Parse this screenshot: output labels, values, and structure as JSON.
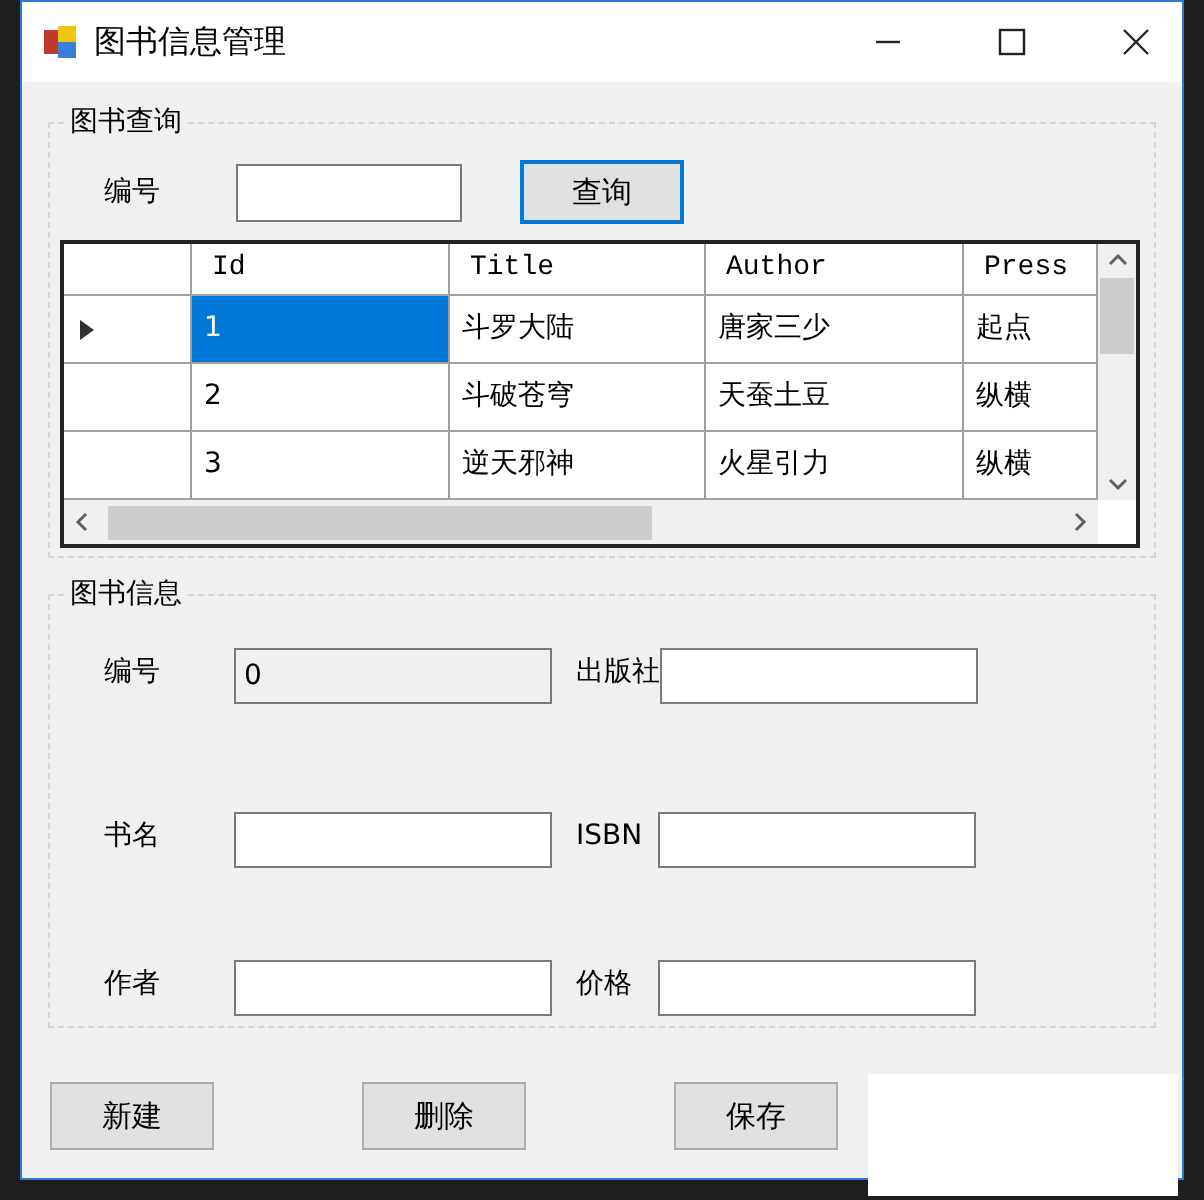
{
  "window": {
    "title": "图书信息管理"
  },
  "query_group": {
    "title": "图书查询",
    "label": "编号",
    "button": "查询"
  },
  "grid": {
    "columns": [
      "Id",
      "Title",
      "Author",
      "Press"
    ],
    "rows": [
      {
        "selected": true,
        "cells": [
          "1",
          "斗罗大陆",
          "唐家三少",
          "起点"
        ]
      },
      {
        "selected": false,
        "cells": [
          "2",
          "斗破苍穹",
          "天蚕土豆",
          "纵横"
        ]
      },
      {
        "selected": false,
        "cells": [
          "3",
          "逆天邪神",
          "火星引力",
          "纵横"
        ]
      }
    ]
  },
  "info_group": {
    "title": "图书信息",
    "fields": [
      {
        "label": "编号",
        "value": "0",
        "disabled": true
      },
      {
        "label": "出版社",
        "disabled": false
      },
      {
        "label": "书名",
        "disabled": false
      },
      {
        "label": "ISBN",
        "disabled": false
      },
      {
        "label": "作者",
        "disabled": false
      },
      {
        "label": "价格",
        "disabled": false
      }
    ]
  },
  "buttons": [
    "新建",
    "删除",
    "保存"
  ]
}
